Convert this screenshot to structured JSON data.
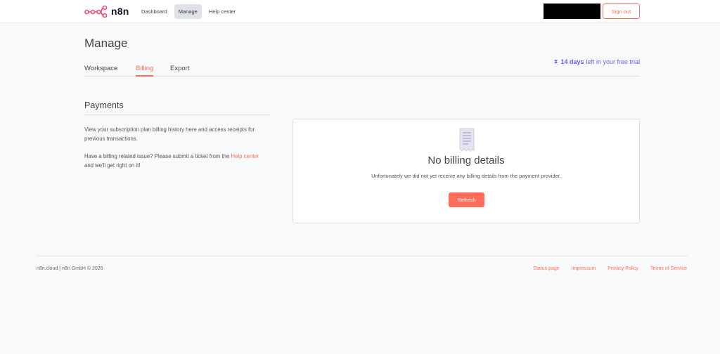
{
  "header": {
    "logo_text": "n8n",
    "nav": [
      {
        "label": "Dashboard",
        "active": false
      },
      {
        "label": "Manage",
        "active": true
      },
      {
        "label": "Help center",
        "active": false
      }
    ],
    "signout_label": "Sign out"
  },
  "page": {
    "title": "Manage",
    "tabs": [
      {
        "label": "Workspace",
        "active": false
      },
      {
        "label": "Billing",
        "active": true
      },
      {
        "label": "Export",
        "active": false
      }
    ],
    "trial": {
      "icon": "hourglass-icon",
      "days": "14 days",
      "rest": "left in your free trial"
    }
  },
  "payments": {
    "title": "Payments",
    "description": "View your subscription plan billing history here and access receipts for previous transactions.",
    "issue_prefix": "Have a billing related issue? Please submit a ticket from the ",
    "issue_link": "Help center",
    "issue_suffix": " and we'll get right on it!"
  },
  "card": {
    "icon": "receipt-icon",
    "title": "No billing details",
    "subtitle": "Unfortunately we did not yet receive any billing details from the payment provider.",
    "button_label": "Refresh"
  },
  "footer": {
    "left_text": "n8n.cloud | n8n GmbH © 2026",
    "links": [
      "Status page",
      "Impressum",
      "Privacy Policy",
      "Terms of Service"
    ]
  },
  "colors": {
    "accent": "#ff6d5a",
    "trial": "#6b5ce7",
    "background": "#f8f9fb"
  }
}
